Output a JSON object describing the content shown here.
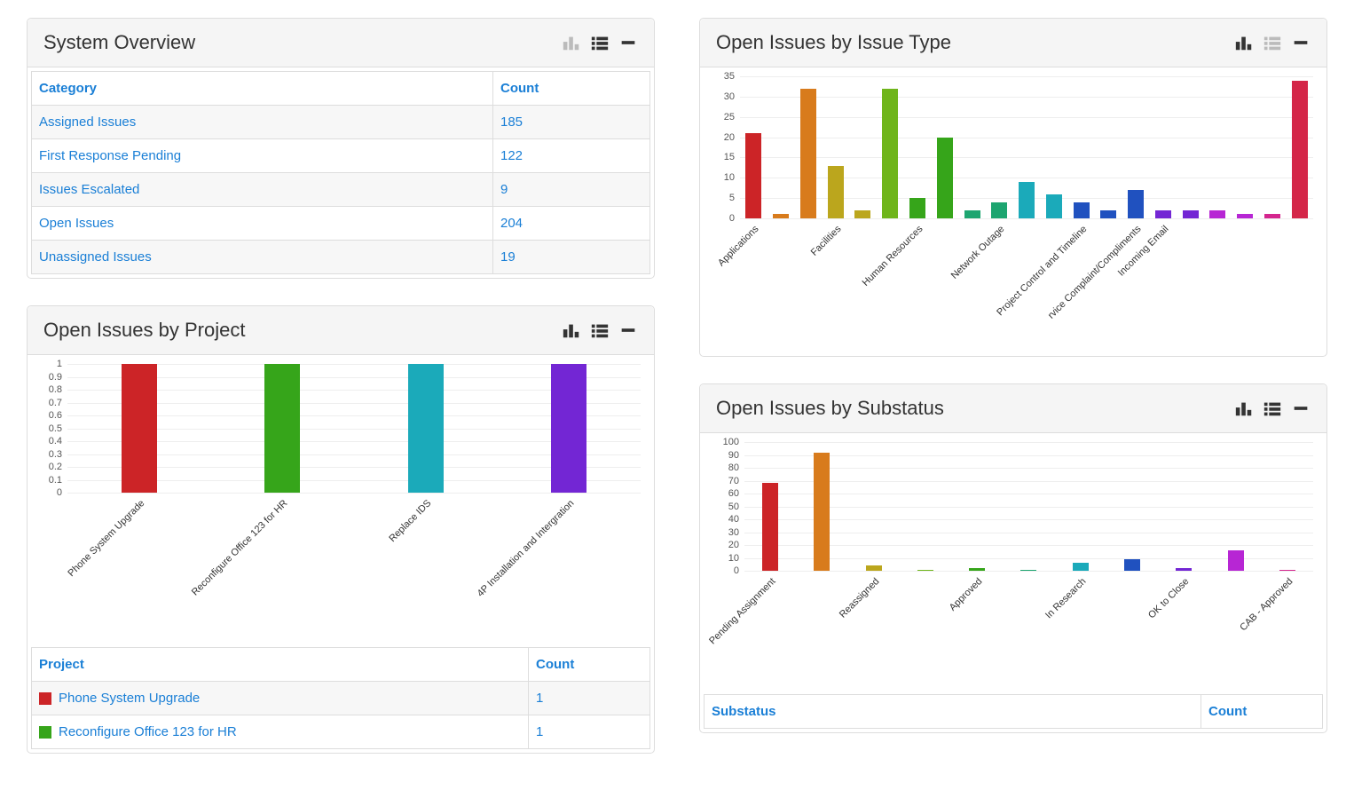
{
  "palette": [
    "#cc2427",
    "#d87b1c",
    "#bba61d",
    "#6fb51b",
    "#36a51a",
    "#1da570",
    "#1baaba",
    "#2051bf",
    "#7326d4",
    "#b726d4",
    "#d4268e",
    "#d42648",
    "#cc2427",
    "#d87b1c",
    "#bba61d",
    "#6fb51b"
  ],
  "panels": {
    "overview": {
      "title": "System Overview",
      "headers": [
        "Category",
        "Count"
      ],
      "rows": [
        {
          "category": "Assigned Issues",
          "count": "185"
        },
        {
          "category": "First Response Pending",
          "count": "122"
        },
        {
          "category": "Issues Escalated",
          "count": "9"
        },
        {
          "category": "Open Issues",
          "count": "204"
        },
        {
          "category": "Unassigned Issues",
          "count": "19"
        }
      ]
    },
    "by_project": {
      "title": "Open Issues by Project",
      "headers": [
        "Project",
        "Count"
      ],
      "rows": [
        {
          "project": "Phone System Upgrade",
          "count": "1",
          "color": "#cc2427"
        },
        {
          "project": "Reconfigure Office 123 for HR",
          "count": "1",
          "color": "#36a51a"
        }
      ]
    },
    "by_type": {
      "title": "Open Issues by Issue Type"
    },
    "by_substatus": {
      "title": "Open Issues by Substatus",
      "headers": [
        "Substatus",
        "Count"
      ]
    }
  },
  "chart_data": [
    {
      "id": "project",
      "type": "bar",
      "title": "Open Issues by Project",
      "ylim": [
        0,
        1
      ],
      "yticks": [
        0,
        0.1,
        0.2,
        0.3,
        0.4,
        0.5,
        0.6,
        0.7,
        0.8,
        0.9,
        1.0
      ],
      "categories": [
        "Phone System Upgrade",
        "Reconfigure Office 123 for HR",
        "Replace IDS",
        "4P Installation and Intergration"
      ],
      "values": [
        1,
        1,
        1,
        1
      ],
      "colors": [
        "#cc2427",
        "#36a51a",
        "#1baaba",
        "#7326d4"
      ]
    },
    {
      "id": "type",
      "type": "bar",
      "title": "Open Issues by Issue Type",
      "ylim": [
        0,
        35
      ],
      "yticks": [
        0,
        5,
        10,
        15,
        20,
        25,
        30,
        35
      ],
      "categories": [
        "Applications",
        "",
        "",
        "Facilities",
        "",
        "",
        "Human Resources",
        "",
        "",
        "Network Outage",
        "",
        "",
        "Project Control and Timeline",
        "",
        "rvice Complaint/Compliments",
        "Incoming Email"
      ],
      "values": [
        21,
        1,
        32,
        13,
        2,
        32,
        5,
        20,
        2,
        4,
        9,
        6,
        4,
        2,
        7,
        2,
        2,
        2,
        1,
        1,
        34
      ],
      "colors": [
        "#cc2427",
        "#d87b1c",
        "#d87b1c",
        "#bba61d",
        "#bba61d",
        "#6fb51b",
        "#36a51a",
        "#36a51a",
        "#1da570",
        "#1da570",
        "#1baaba",
        "#1baaba",
        "#2051bf",
        "#2051bf",
        "#2051bf",
        "#7326d4",
        "#7326d4",
        "#b726d4",
        "#b726d4",
        "#d4268e",
        "#d42648"
      ]
    },
    {
      "id": "substatus",
      "type": "bar",
      "title": "Open Issues by Substatus",
      "ylim": [
        0,
        100
      ],
      "yticks": [
        0,
        10,
        20,
        30,
        40,
        50,
        60,
        70,
        80,
        90,
        100
      ],
      "categories": [
        "Pending Assignment",
        "",
        "Reassigned",
        "",
        "Approved",
        "",
        "In Research",
        "",
        "OK to Close",
        "",
        "CAB - Approved"
      ],
      "values": [
        68,
        92,
        4,
        1,
        2,
        1,
        6,
        9,
        2,
        16,
        1
      ],
      "colors": [
        "#cc2427",
        "#d87b1c",
        "#bba61d",
        "#6fb51b",
        "#36a51a",
        "#1da570",
        "#1baaba",
        "#2051bf",
        "#7326d4",
        "#b726d4",
        "#d4268e"
      ]
    }
  ]
}
